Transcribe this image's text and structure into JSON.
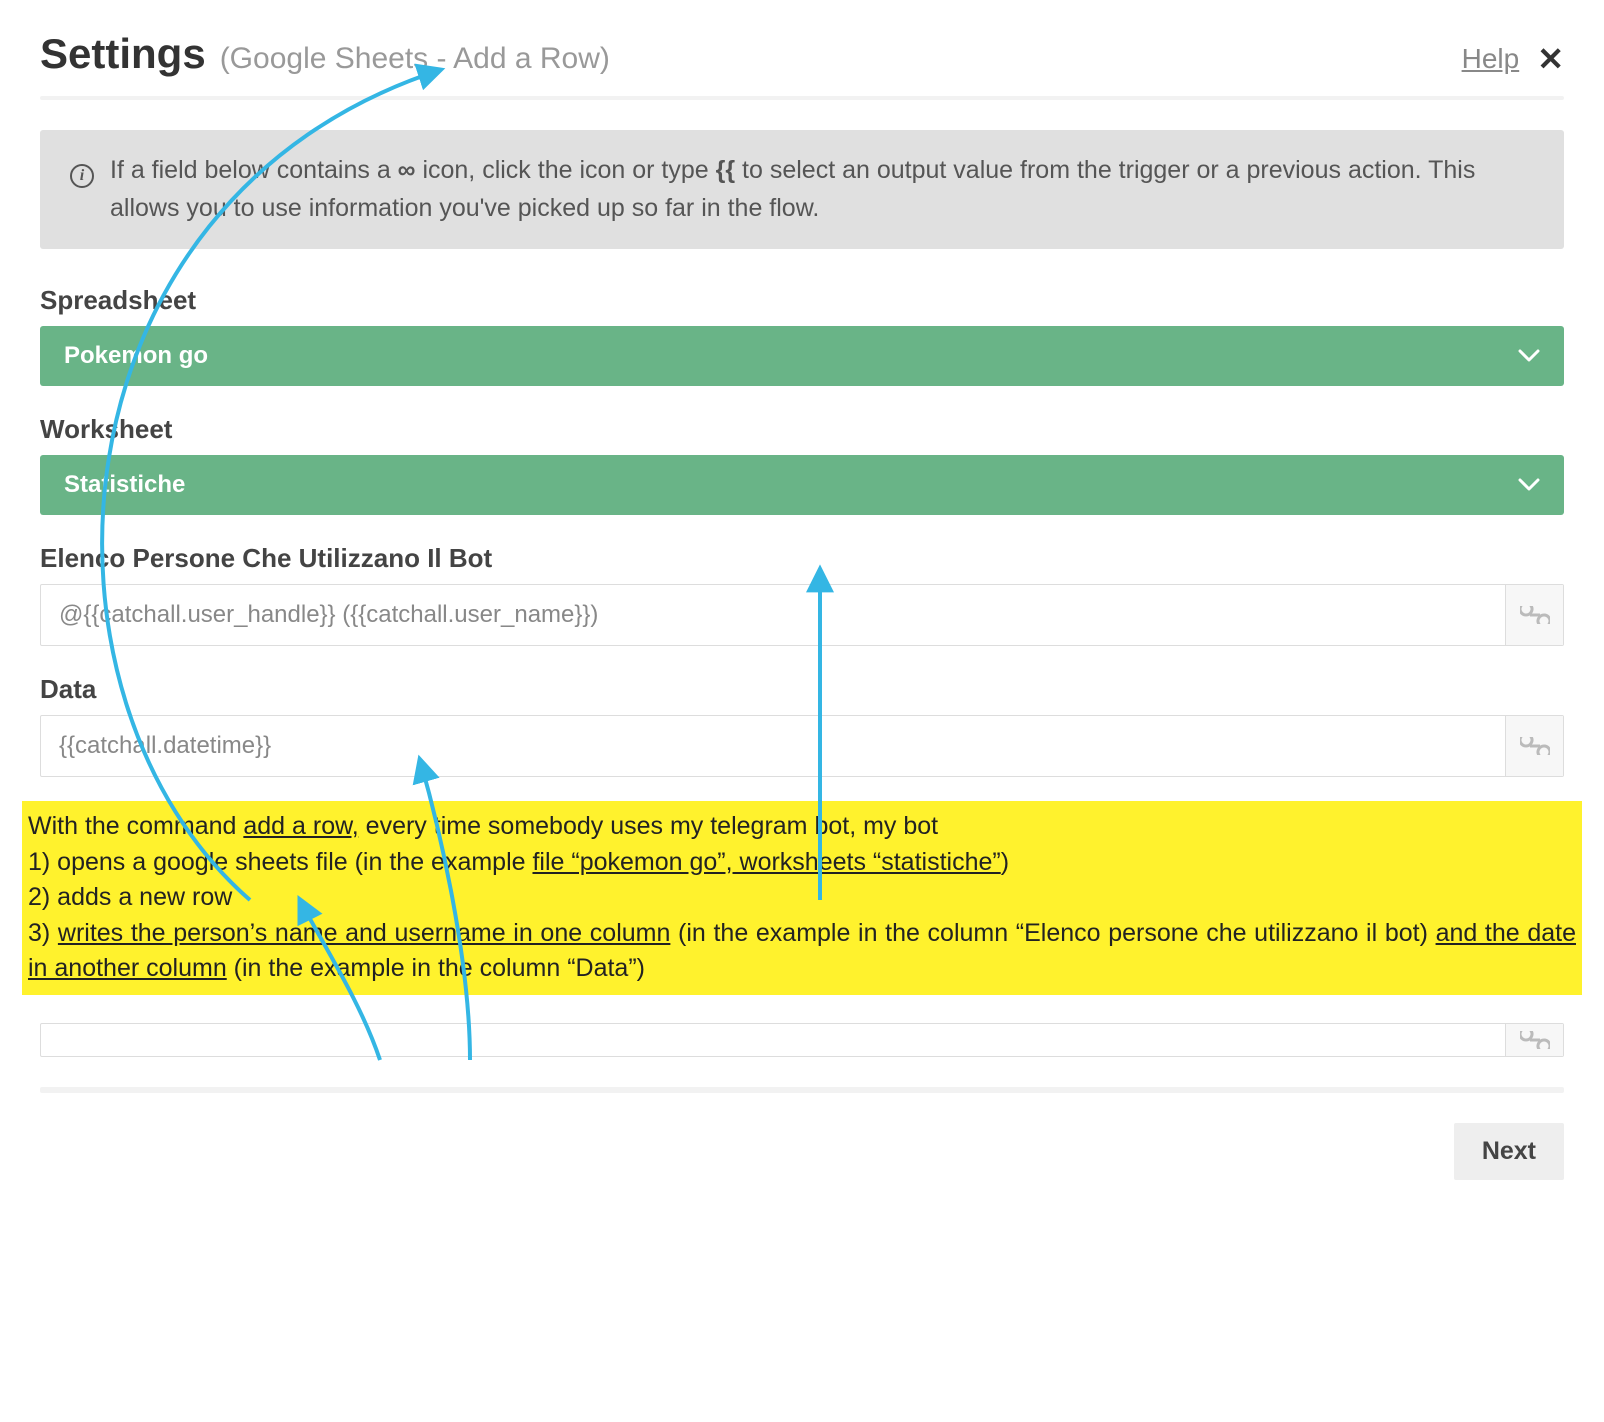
{
  "header": {
    "title": "Settings",
    "subtitle": "(Google Sheets - Add a Row)",
    "help": "Help"
  },
  "info": {
    "pre": "If a field below contains a ",
    "mid": " icon, click the icon or type ",
    "brace": "{{",
    "post": " to select an output value from the trigger or a previous action. This allows you to use information you've picked up so far in the flow."
  },
  "fields": {
    "spreadsheet": {
      "label": "Spreadsheet",
      "value": "Pokemon go"
    },
    "worksheet": {
      "label": "Worksheet",
      "value": "Statistiche"
    },
    "col1": {
      "label": "Elenco Persone Che Utilizzano Il Bot",
      "value": "@{{catchall.user_handle}} ({{catchall.user_name}})"
    },
    "col2": {
      "label": "Data",
      "value": "{{catchall.datetime}}"
    },
    "col3": {
      "value": ""
    }
  },
  "annotation": {
    "l0a": "With the command ",
    "l0u": "add a row,",
    "l0b": " every time somebody uses my telegram bot, my bot",
    "l1a": "1) opens a google sheets file (in the example ",
    "l1u": "file “pokemon go”, worksheets “statistiche”",
    "l1b": ")",
    "l2": "2) adds a new row",
    "l3a": "3) ",
    "l3u1": "writes the person’s name and username in one column",
    "l3b": " (in the example in the column “Elenco persone che utilizzano il bot) ",
    "l3u2": "and the date in another column",
    "l3c": " (in the example in the column “Data”)"
  },
  "footer": {
    "next": "Next"
  },
  "icons": {
    "link": "⚗"
  }
}
